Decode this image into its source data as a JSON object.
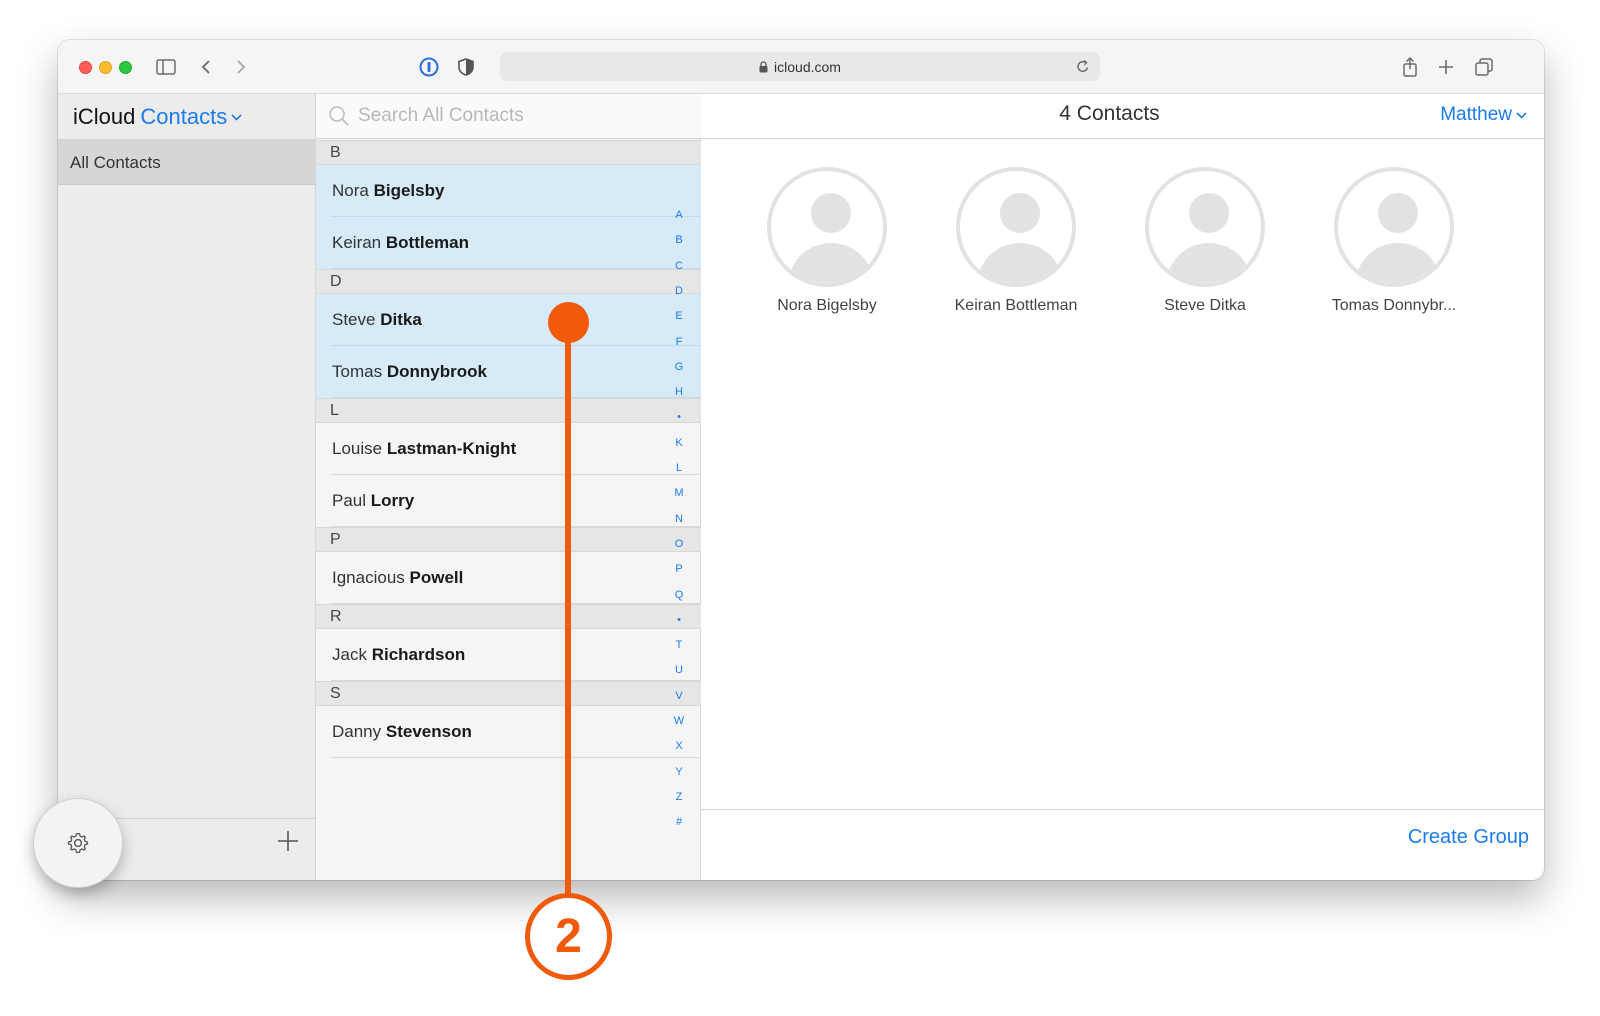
{
  "browser": {
    "url": "icloud.com"
  },
  "sidebar": {
    "app_name": "iCloud",
    "app_section": "Contacts",
    "groups": [
      {
        "label": "All Contacts",
        "selected": true
      }
    ]
  },
  "search": {
    "placeholder": "Search All Contacts"
  },
  "contact_list": {
    "sections": [
      {
        "letter": "B",
        "contacts": [
          {
            "first": "Nora",
            "last": "Bigelsby",
            "selected": true
          },
          {
            "first": "Keiran",
            "last": "Bottleman",
            "selected": true
          }
        ]
      },
      {
        "letter": "D",
        "contacts": [
          {
            "first": "Steve",
            "last": "Ditka",
            "selected": true
          },
          {
            "first": "Tomas",
            "last": "Donnybrook",
            "selected": true
          }
        ]
      },
      {
        "letter": "L",
        "contacts": [
          {
            "first": "Louise",
            "last": "Lastman-Knight",
            "selected": false
          },
          {
            "first": "Paul",
            "last": "Lorry",
            "selected": false
          }
        ]
      },
      {
        "letter": "P",
        "contacts": [
          {
            "first": "Ignacious",
            "last": "Powell",
            "selected": false
          }
        ]
      },
      {
        "letter": "R",
        "contacts": [
          {
            "first": "Jack",
            "last": "Richardson",
            "selected": false
          }
        ]
      },
      {
        "letter": "S",
        "contacts": [
          {
            "first": "Danny",
            "last": "Stevenson",
            "selected": false
          }
        ]
      }
    ],
    "index_letters": [
      "A",
      "B",
      "C",
      "D",
      "E",
      "F",
      "G",
      "H",
      "•",
      "K",
      "L",
      "M",
      "N",
      "O",
      "P",
      "Q",
      "•",
      "T",
      "U",
      "V",
      "W",
      "X",
      "Y",
      "Z",
      "#"
    ]
  },
  "details": {
    "count_label": "4 Contacts",
    "user_label": "Matthew",
    "selected_cards": [
      "Nora Bigelsby",
      "Keiran Bottleman",
      "Steve Ditka",
      "Tomas Donnybr..."
    ],
    "create_group_label": "Create Group"
  },
  "callout": {
    "number": "2",
    "color": "#f05a0a"
  },
  "colors": {
    "accent": "#1a7cf0",
    "selection": "#d6eaf8"
  }
}
